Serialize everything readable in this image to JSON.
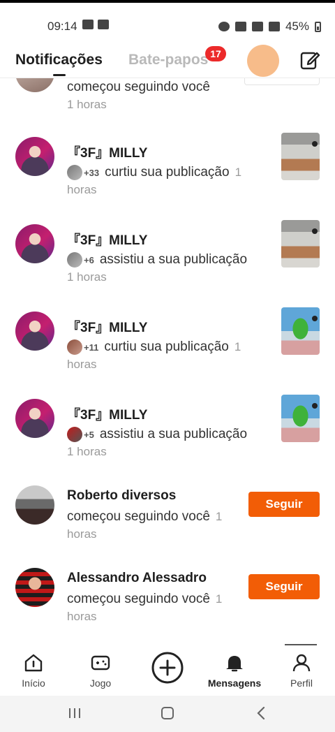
{
  "status_bar": {
    "time": "09:14",
    "battery": "45%"
  },
  "header": {
    "tab_notifications": "Notificações",
    "tab_chats": "Bate-papos",
    "chats_badge": "17",
    "compose_icon": "compose-icon"
  },
  "notifications": [
    {
      "name": "",
      "action": "começou seguindo você",
      "time": "1 horas",
      "partial": true
    },
    {
      "name": "『3F』MILLY",
      "stack_count": "+33",
      "action": "curtiu sua publicação",
      "time_inline": "1",
      "time": "horas"
    },
    {
      "name": "『3F』MILLY",
      "stack_count": "+6",
      "action": "assistiu a sua publicação",
      "time": "1 horas"
    },
    {
      "name": "『3F』MILLY",
      "stack_count": "+11",
      "action": "curtiu sua publicação",
      "time_inline": "1",
      "time": "horas"
    },
    {
      "name": "『3F』MILLY",
      "stack_count": "+5",
      "action": "assistiu a sua publicação",
      "time": "1 horas"
    },
    {
      "name": "Roberto diversos",
      "action": "começou seguindo você",
      "time_inline": "1",
      "time": "horas",
      "button": "Seguir"
    },
    {
      "name": "Alessandro Alessadro",
      "action": "começou seguindo você",
      "time_inline": "1",
      "time": "horas",
      "button": "Seguir"
    }
  ],
  "bottom_nav": [
    {
      "label": "Início",
      "icon": "home-icon"
    },
    {
      "label": "Jogo",
      "icon": "gamepad-icon"
    },
    {
      "label": "",
      "icon": "plus-circle-icon"
    },
    {
      "label": "Mensagens",
      "icon": "bell-icon",
      "active": true
    },
    {
      "label": "Perfil",
      "icon": "person-icon"
    }
  ],
  "colors": {
    "accent": "#f25d06",
    "badge": "#ec2a2a"
  }
}
